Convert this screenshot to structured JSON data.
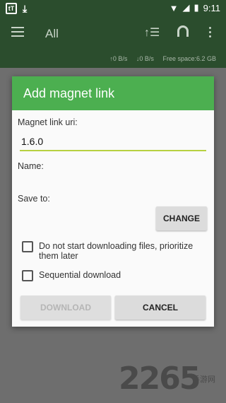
{
  "status_bar": {
    "time": "9:11"
  },
  "app_bar": {
    "title": "All",
    "speed_up": "↑0 B/s",
    "speed_down": "↓0 B/s",
    "free_space": "Free space:6.2 GB"
  },
  "dialog": {
    "title": "Add magnet link",
    "uri_label": "Magnet link uri:",
    "uri_value": "1.6.0",
    "name_label": "Name:",
    "save_to_label": "Save to:",
    "change_label": "CHANGE",
    "option_prioritize": "Do not start downloading files, prioritize them later",
    "option_sequential": "Sequential download",
    "download_label": "DOWNLOAD",
    "cancel_label": "CANCEL"
  },
  "watermark": {
    "text": "2265",
    "sub": "手游网"
  }
}
